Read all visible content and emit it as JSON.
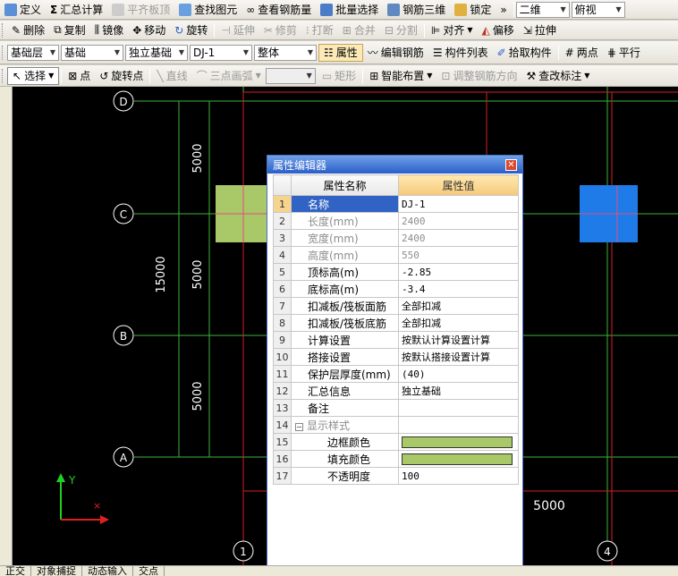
{
  "toolbar1": {
    "define": "定义",
    "summary_calc": "汇总计算",
    "flush_board_top": "平齐板顶",
    "find_element": "查找图元",
    "view_rebar_qty": "查看钢筋量",
    "batch_select": "批量选择",
    "rebar_3d": "钢筋三维",
    "lock": "锁定",
    "more": "»",
    "view_mode": "二维",
    "view_dir": "俯视",
    "accent": "#316ac5"
  },
  "toolbar2": {
    "delete": "删除",
    "copy": "复制",
    "mirror": "镜像",
    "move": "移动",
    "rotate": "旋转",
    "extend": "延伸",
    "trim": "修剪",
    "break": "打断",
    "merge": "合并",
    "split": "分割",
    "align": "对齐",
    "offset": "偏移",
    "stretch": "拉伸"
  },
  "toolbar3": {
    "layer": "基础层",
    "category": "基础",
    "type": "独立基础",
    "component": "DJ-1",
    "part": "整体",
    "properties": "属性",
    "edit_rebar": "编辑钢筋",
    "component_list": "构件列表",
    "pick_component": "拾取构件",
    "two_points": "两点",
    "parallel": "平行"
  },
  "toolbar4": {
    "select": "选择",
    "point": "点",
    "rotate_point": "旋转点",
    "line": "直线",
    "three_point_arc": "三点画弧",
    "rectangle": "矩形",
    "smart_layout": "智能布置",
    "adjust_rebar_dir": "调整钢筋方向",
    "check_labels": "查改标注"
  },
  "drawing": {
    "axis_top": "D",
    "axis_c": "C",
    "axis_b": "B",
    "axis_a": "A",
    "axis_1": "1",
    "axis_4": "4",
    "dim_5000_top": "5000",
    "dim_5000_mid": "5000",
    "dim_5000_low": "5000",
    "dim_15000": "15000",
    "dim_5000_bottom": "5000",
    "ucs_y": "Y",
    "foundation_left_color": "#a9c868",
    "foundation_right_color": "#1e7be8",
    "grid_line_color": "#3cb43c",
    "wall_line_color": "#d82020"
  },
  "property_editor": {
    "title": "属性编辑器",
    "close": "✕",
    "header_name": "属性名称",
    "header_value": "属性值",
    "rows": [
      {
        "num": "1",
        "name": "名称",
        "value": "DJ-1"
      },
      {
        "num": "2",
        "name": "长度(mm)",
        "value": "2400"
      },
      {
        "num": "3",
        "name": "宽度(mm)",
        "value": "2400"
      },
      {
        "num": "4",
        "name": "高度(mm)",
        "value": "550"
      },
      {
        "num": "5",
        "name": "顶标高(m)",
        "value": "-2.85"
      },
      {
        "num": "6",
        "name": "底标高(m)",
        "value": "-3.4"
      },
      {
        "num": "7",
        "name": "扣减板/筏板面筋",
        "value": "全部扣减"
      },
      {
        "num": "8",
        "name": "扣减板/筏板底筋",
        "value": "全部扣减"
      },
      {
        "num": "9",
        "name": "计算设置",
        "value": "按默认计算设置计算"
      },
      {
        "num": "10",
        "name": "搭接设置",
        "value": "按默认搭接设置计算"
      },
      {
        "num": "11",
        "name": "保护层厚度(mm)",
        "value": "(40)"
      },
      {
        "num": "12",
        "name": "汇总信息",
        "value": "独立基础"
      },
      {
        "num": "13",
        "name": "备注",
        "value": ""
      },
      {
        "num": "14",
        "name": "显示样式",
        "value": ""
      },
      {
        "num": "15",
        "name": "边框颜色",
        "value": ""
      },
      {
        "num": "16",
        "name": "填充颜色",
        "value": ""
      },
      {
        "num": "17",
        "name": "不透明度",
        "value": "100"
      }
    ],
    "collapse": "−",
    "swatch_color": "#a9c868"
  },
  "statusbar": {
    "orthogonal": "正交",
    "snap": "对象捕捉",
    "dynamic_input": "动态输入",
    "intersection": "交点"
  }
}
